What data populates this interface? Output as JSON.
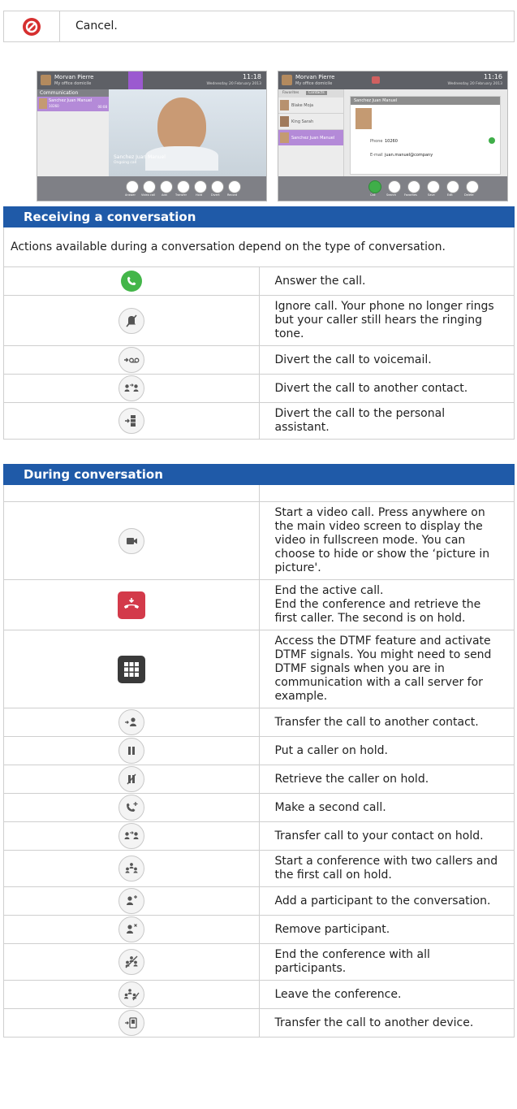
{
  "cancel_row": {
    "icon": "cancel-icon",
    "text": "Cancel."
  },
  "screenshot_video": {
    "user_name": "Morvan Pierre",
    "user_status": "My office domicile",
    "time": "11:18",
    "date": "Wednesday 20 February 2013",
    "sidebar_title": "Communication",
    "contact_name": "Sanchez Juan Manuel",
    "contact_number": "10260",
    "call_duration": "00:08",
    "caller_name": "Sanchez Juan Manuel",
    "caller_status": "Ongoing call",
    "buttons": [
      "Answer",
      "Video call",
      "Add",
      "Transfer",
      "Hold",
      "Divert",
      "Record"
    ]
  },
  "screenshot_contact": {
    "user_name": "Morvan Pierre",
    "user_status": "My office domicile",
    "time": "11:16",
    "date": "Wednesday 20 February 2013",
    "tabs": [
      "Favorites",
      "Contacts"
    ],
    "contacts": [
      "Blake Moja",
      "King Sarah",
      "Sanchez Juan Manuel"
    ],
    "detail_name": "Sanchez Juan Manuel",
    "phone_label": "Phone",
    "phone_value": "10260",
    "email_label": "E-mail",
    "email_value": "juan.manuel@company",
    "buttons": [
      "Call",
      "Search",
      "Favorites",
      "Save",
      "Edit",
      "Delete"
    ]
  },
  "receiving": {
    "header": "Receiving a conversation",
    "intro": "Actions available during a conversation depend on the type of conversation.",
    "rows": [
      {
        "icon": "answer-call-icon",
        "text": "Answer the call."
      },
      {
        "icon": "ignore-call-icon",
        "text": "Ignore call. Your phone no longer rings but your caller still hears the ringing tone."
      },
      {
        "icon": "divert-voicemail-icon",
        "text": "Divert the call to voicemail."
      },
      {
        "icon": "divert-contact-icon",
        "text": "Divert the call to another contact."
      },
      {
        "icon": "divert-assistant-icon",
        "text": "Divert the call to the personal assistant."
      }
    ]
  },
  "during": {
    "header": "During conversation",
    "rows": [
      {
        "icon": "video-call-icon",
        "text": "Start a video call. Press anywhere on the main video screen to display the video in fullscreen mode. You can choose to hide or show the ‘picture in picture'."
      },
      {
        "icon": "end-call-icon",
        "text_lines": [
          "End the active call.",
          "End the conference and retrieve the first caller. The second is on hold."
        ]
      },
      {
        "icon": "dtmf-keypad-icon",
        "text": "Access the DTMF feature and activate DTMF signals. You might need to send DTMF signals when you are in communication with a call server for example."
      },
      {
        "icon": "transfer-contact-icon",
        "text": "Transfer the call to another contact."
      },
      {
        "icon": "hold-icon",
        "text": "Put a caller on hold."
      },
      {
        "icon": "retrieve-hold-icon",
        "text": "Retrieve the caller on hold."
      },
      {
        "icon": "second-call-icon",
        "text": "Make a second call."
      },
      {
        "icon": "transfer-hold-icon",
        "text": "Transfer call to your contact on hold."
      },
      {
        "icon": "conference-icon",
        "text": "Start a conference with two callers and the first call on hold."
      },
      {
        "icon": "add-participant-icon",
        "text": "Add a participant to the conversation."
      },
      {
        "icon": "remove-participant-icon",
        "text": "Remove participant."
      },
      {
        "icon": "end-conference-icon",
        "text": "End the conference with all participants."
      },
      {
        "icon": "leave-conference-icon",
        "text": "Leave the conference."
      },
      {
        "icon": "transfer-device-icon",
        "text": "Transfer the call to another device."
      }
    ]
  }
}
